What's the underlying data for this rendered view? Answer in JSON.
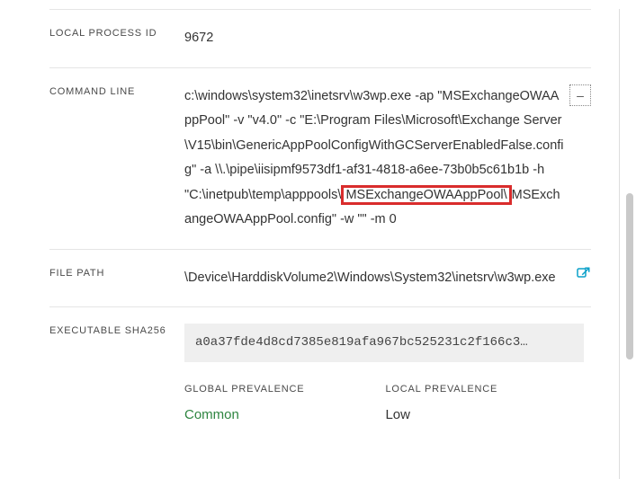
{
  "fields": {
    "localProcessId": {
      "label": "LOCAL PROCESS ID",
      "value": "9672"
    },
    "commandLine": {
      "label": "COMMAND LINE",
      "part1": "c:\\windows\\system32\\inetsrv\\w3wp.exe -ap \"MSExchangeOWAAppPool\" -v \"v4.0\" -c \"E:\\Program Files\\Microsoft\\Exchange Server\\V15\\bin\\GenericAppPoolConfigWithGCServerEnabledFalse.config\" -a \\\\.\\pipe\\iisipmf9573df1-af31-4818-a6ee-73b0b5c61b1b -h \"C:\\inetpub\\temp\\apppools\\",
      "highlight": "MSExchangeOWAAppPool\\",
      "part2": "MSExchangeOWAAppPool.config\" -w \"\" -m 0"
    },
    "filePath": {
      "label": "FILE PATH",
      "value": "\\Device\\HarddiskVolume2\\Windows\\System32\\inetsrv\\w3wp.exe"
    },
    "sha256": {
      "label": "EXECUTABLE SHA256",
      "value": "a0a37fde4d8cd7385e819afa967bc525231c2f166c3…"
    },
    "prevalence": {
      "globalLabel": "GLOBAL PREVALENCE",
      "globalValue": "Common",
      "localLabel": "LOCAL PREVALENCE",
      "localValue": "Low"
    }
  },
  "icons": {
    "collapse": "–"
  }
}
